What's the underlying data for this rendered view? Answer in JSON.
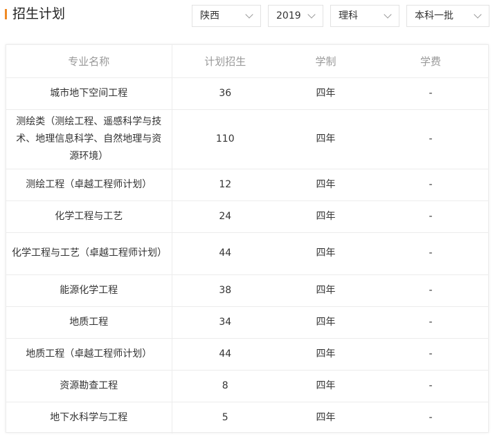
{
  "header": {
    "title": "招生计划",
    "filters": {
      "province": "陕西",
      "year": "2019",
      "subject": "理科",
      "batch": "本科一批"
    }
  },
  "colors": {
    "accent": "#f08a24"
  },
  "table": {
    "columns": [
      "专业名称",
      "计划招生",
      "学制",
      "学费"
    ],
    "rows": [
      {
        "major": "城市地下空间工程",
        "quota": "36",
        "duration": "四年",
        "tuition": "-"
      },
      {
        "major": "测绘类（测绘工程、遥感科学与技术、地理信息科学、自然地理与资源环境）",
        "quota": "110",
        "duration": "四年",
        "tuition": "-"
      },
      {
        "major": "测绘工程（卓越工程师计划）",
        "quota": "12",
        "duration": "四年",
        "tuition": "-"
      },
      {
        "major": "化学工程与工艺",
        "quota": "24",
        "duration": "四年",
        "tuition": "-"
      },
      {
        "major": "化学工程与工艺（卓越工程师计划）",
        "quota": "44",
        "duration": "四年",
        "tuition": "-"
      },
      {
        "major": "能源化学工程",
        "quota": "38",
        "duration": "四年",
        "tuition": "-"
      },
      {
        "major": "地质工程",
        "quota": "34",
        "duration": "四年",
        "tuition": "-"
      },
      {
        "major": "地质工程（卓越工程师计划）",
        "quota": "44",
        "duration": "四年",
        "tuition": "-"
      },
      {
        "major": "资源勘查工程",
        "quota": "8",
        "duration": "四年",
        "tuition": "-"
      },
      {
        "major": "地下水科学与工程",
        "quota": "5",
        "duration": "四年",
        "tuition": "-"
      }
    ]
  }
}
